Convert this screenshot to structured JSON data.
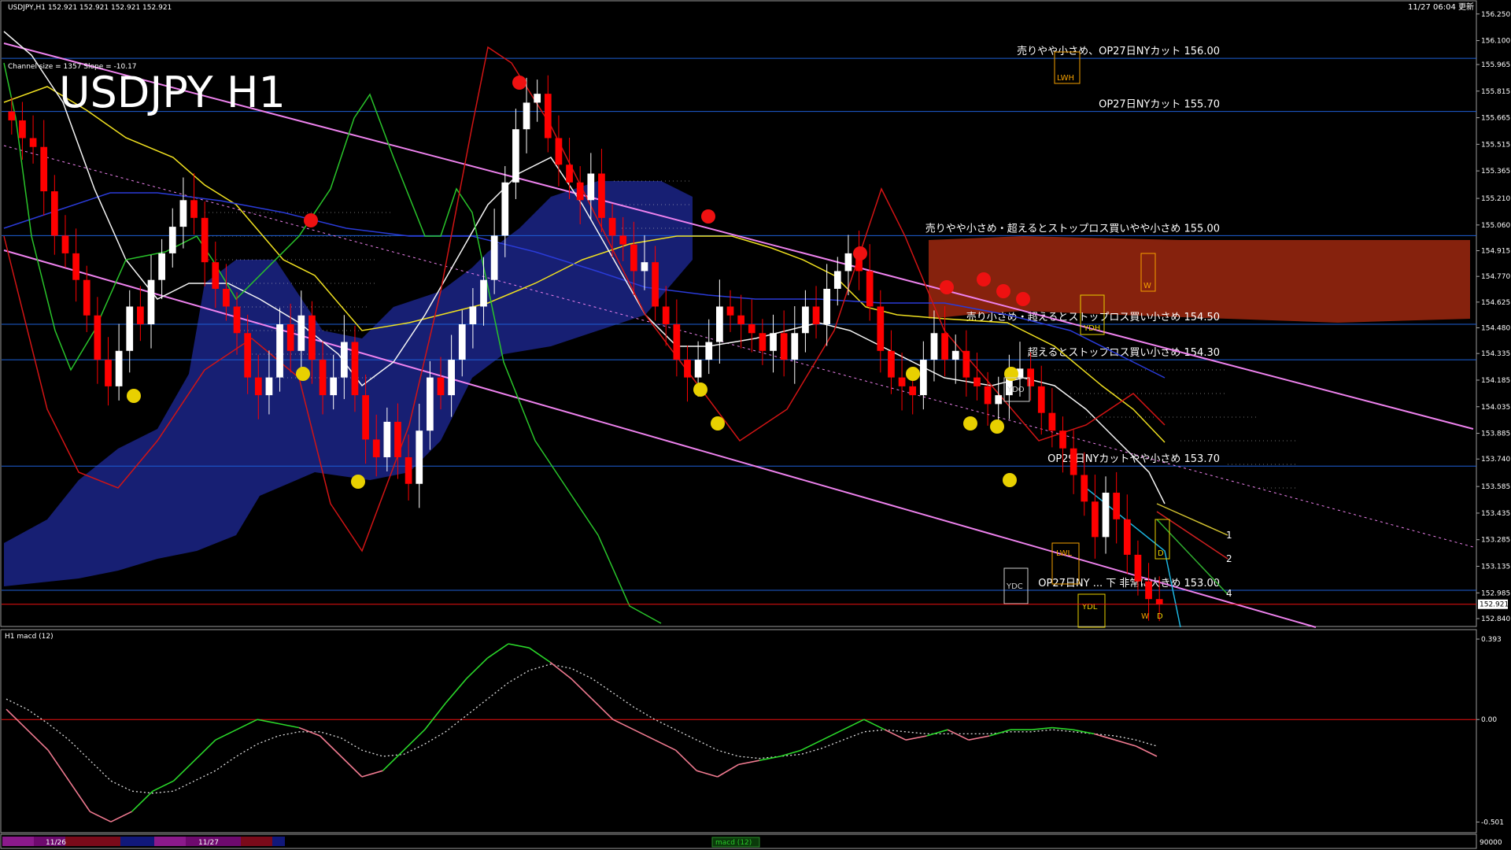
{
  "header": {
    "symbol_line": "USDJPY,H1  152.921 152.921 152.921 152.921",
    "channel_info": "Channel size = 1357 Slope = -10.17",
    "big_title": "USDJPY H1",
    "datetime": "11/27 06:04 更新"
  },
  "chart_data": [
    {
      "type": "candlestick",
      "title": "USDJPY H1",
      "y_ticks": [
        "156.250",
        "156.100",
        "155.965",
        "155.815",
        "155.665",
        "155.515",
        "155.365",
        "155.210",
        "155.060",
        "154.915",
        "154.770",
        "154.625",
        "154.480",
        "154.335",
        "154.185",
        "154.035",
        "153.885",
        "153.740",
        "153.585",
        "153.435",
        "153.285",
        "153.135",
        "152.985",
        "152.840"
      ],
      "ylim": [
        152.8,
        156.32
      ],
      "current_price": "152.921",
      "current_price_value": 152.921,
      "levels": [
        {
          "price": 156.0,
          "label": "売りやや小さめ、OP27日NYカット 156.00"
        },
        {
          "price": 155.7,
          "label": "OP27日NYカット 155.70"
        },
        {
          "price": 155.0,
          "label": "売りやや小さめ・超えるとストップロス買いやや小さめ 155.00"
        },
        {
          "price": 154.5,
          "label": "売り小さめ・超えるとストップロス買い小さめ 154.50"
        },
        {
          "price": 154.3,
          "label": "超えるとストップロス買い小さめ 154.30"
        },
        {
          "price": 153.7,
          "label": "OP29日NYカットやや小さめ 153.70"
        },
        {
          "price": 153.0,
          "label": "OP27日NY ... 下 非常に大きめ 153.00"
        }
      ],
      "marker_labels": [
        "LWH",
        "YDH",
        "YDO",
        "YDC",
        "YDL",
        "LWL",
        "W",
        "D",
        "1",
        "2",
        "4"
      ],
      "close_series": [
        155.65,
        155.55,
        155.5,
        155.25,
        155.0,
        154.9,
        154.75,
        154.55,
        154.3,
        154.15,
        154.35,
        154.6,
        154.5,
        154.75,
        154.9,
        155.05,
        155.2,
        155.1,
        154.85,
        154.7,
        154.6,
        154.45,
        154.2,
        154.1,
        154.2,
        154.5,
        154.35,
        154.55,
        154.3,
        154.1,
        154.2,
        154.4,
        154.1,
        153.85,
        153.75,
        153.95,
        153.75,
        153.6,
        153.9,
        154.2,
        154.1,
        154.3,
        154.5,
        154.6,
        154.75,
        155.0,
        155.3,
        155.6,
        155.75,
        155.8,
        155.55,
        155.4,
        155.3,
        155.2,
        155.35,
        155.1,
        155.0,
        154.95,
        154.8,
        154.85,
        154.6,
        154.5,
        154.3,
        154.2,
        154.3,
        154.4,
        154.6,
        154.55,
        154.5,
        154.45,
        154.35,
        154.45,
        154.3,
        154.45,
        154.6,
        154.5,
        154.7,
        154.8,
        154.9,
        154.8,
        154.6,
        154.35,
        154.2,
        154.15,
        154.1,
        154.3,
        154.45,
        154.3,
        154.35,
        154.2,
        154.15,
        154.05,
        154.1,
        154.2,
        154.25,
        154.15,
        154.0,
        153.9,
        153.8,
        153.65,
        153.5,
        153.3,
        153.55,
        153.4,
        153.2,
        153.05,
        152.95,
        152.92
      ],
      "x_date_labels": [
        "11/26",
        "11/27"
      ]
    },
    {
      "type": "line",
      "title": "H1  macd (12)",
      "y_ticks": [
        "0.393",
        "0.00",
        "-0.501"
      ],
      "ylim": [
        -0.53,
        0.42
      ],
      "series": [
        {
          "name": "macd (12)",
          "values": [
            0.05,
            -0.05,
            -0.15,
            -0.3,
            -0.45,
            -0.5,
            -0.45,
            -0.35,
            -0.3,
            -0.2,
            -0.1,
            -0.05,
            0.0,
            -0.02,
            -0.04,
            -0.08,
            -0.18,
            -0.28,
            -0.25,
            -0.15,
            -0.05,
            0.08,
            0.2,
            0.3,
            0.37,
            0.35,
            0.28,
            0.2,
            0.1,
            0.0,
            -0.05,
            -0.1,
            -0.15,
            -0.25,
            -0.28,
            -0.22,
            -0.2,
            -0.18,
            -0.15,
            -0.1,
            -0.05,
            0.0,
            -0.05,
            -0.1,
            -0.08,
            -0.05,
            -0.1,
            -0.08,
            -0.05,
            -0.05,
            -0.04,
            -0.05,
            -0.07,
            -0.1,
            -0.13,
            -0.18
          ]
        },
        {
          "name": "signal",
          "values": [
            0.1,
            0.05,
            -0.02,
            -0.1,
            -0.2,
            -0.3,
            -0.35,
            -0.36,
            -0.35,
            -0.3,
            -0.25,
            -0.18,
            -0.12,
            -0.08,
            -0.06,
            -0.06,
            -0.09,
            -0.15,
            -0.18,
            -0.17,
            -0.12,
            -0.06,
            0.02,
            0.1,
            0.18,
            0.24,
            0.27,
            0.25,
            0.2,
            0.13,
            0.06,
            0.0,
            -0.05,
            -0.1,
            -0.15,
            -0.18,
            -0.19,
            -0.18,
            -0.17,
            -0.14,
            -0.1,
            -0.06,
            -0.05,
            -0.06,
            -0.07,
            -0.07,
            -0.07,
            -0.07,
            -0.06,
            -0.06,
            -0.05,
            -0.06,
            -0.07,
            -0.08,
            -0.1,
            -0.13
          ]
        }
      ]
    }
  ],
  "footer": {
    "dates": [
      "11/26",
      "11/27"
    ],
    "badge": "macd (12)",
    "right_value": "90000"
  },
  "colors": {
    "bull": "#ffffff",
    "bear": "#ff0000",
    "channel": "#ee82ee",
    "level": "#1e5fd6",
    "kumo_blue": "#1f2a9a",
    "kumo_red": "#cc3311",
    "yellow": "#f0e020",
    "green": "#28c828"
  }
}
